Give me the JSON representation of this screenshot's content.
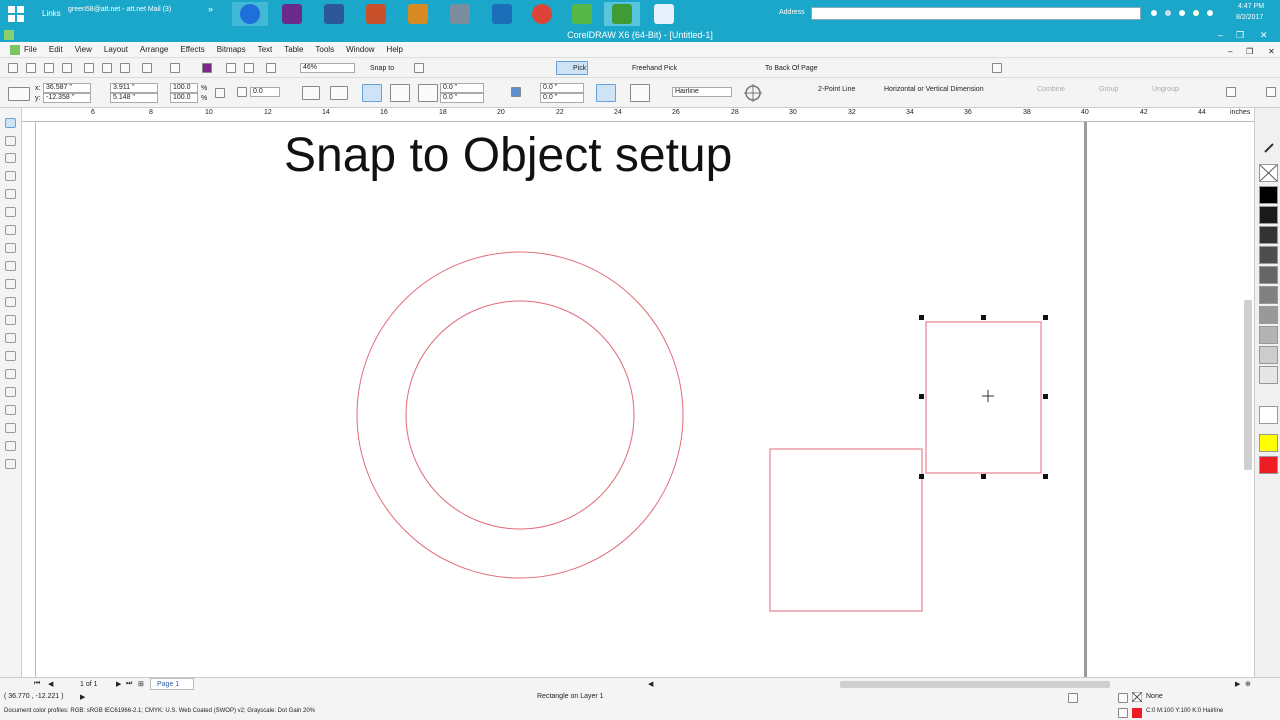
{
  "taskbar": {
    "links_label": "Links",
    "email_label": "green58@att.net - att.net Mail (3)",
    "chevron": "»",
    "address_label": "Address",
    "clock_time": "4:47 PM",
    "clock_date": "8/2/2017"
  },
  "app": {
    "title": "CorelDRAW X6 (64-Bit) - [Untitled-1]"
  },
  "menu": {
    "items": [
      "File",
      "Edit",
      "View",
      "Layout",
      "Arrange",
      "Effects",
      "Bitmaps",
      "Text",
      "Table",
      "Tools",
      "Window",
      "Help"
    ]
  },
  "toolbar1": {
    "zoom": "46%",
    "snap_to": "Snap to",
    "pick": "Pick",
    "freehand_pick": "Freehand Pick",
    "to_back_of_page": "To Back Of Page"
  },
  "toolbar2": {
    "x_label": "x:",
    "x_value": "36.587 \"",
    "y_label": "y:",
    "y_value": "-12.358 \"",
    "width_value": "3.911 \"",
    "height_value": "5.148 \"",
    "scale_x": "100.0",
    "scale_y": "100.0",
    "percent": "%",
    "rotation": "0.0",
    "pos_x1": "0.0 \"",
    "pos_y1": "0.0 \"",
    "pos_x2": "0.0 \"",
    "pos_y2": "0.0 \"",
    "outline": "Hairline",
    "two_point_line": "2-Point Line",
    "dimension": "Horizontal or Vertical Dimension",
    "combine": "Combine",
    "group": "Group",
    "ungroup": "Ungroup"
  },
  "ruler": {
    "ticks": [
      "6",
      "8",
      "10",
      "12",
      "14",
      "16",
      "18",
      "20",
      "22",
      "24",
      "26",
      "28",
      "30",
      "32",
      "34",
      "36",
      "38",
      "40",
      "42",
      "44"
    ],
    "units": "inches"
  },
  "canvas": {
    "heading": "Snap to Object setup",
    "shape_color": "#e06b78"
  },
  "palette": {
    "colors": [
      "#000000",
      "#1a1a1a",
      "#333333",
      "#4d4d4d",
      "#666666",
      "#808080",
      "#999999",
      "#b3b3b3",
      "#cccccc",
      "#e6e6e6",
      "#ffffff",
      "#ffff00",
      "#ee1c25"
    ]
  },
  "status": {
    "page_count": "1 of 1",
    "page_tab": "Page 1",
    "coords": "( 36.770 , -12.221 )",
    "object_info": "Rectangle on Layer 1",
    "fill_none": "None",
    "outline_info": "C:0 M:100 Y:100 K:0  Hairline",
    "profiles": "Document color profiles: RGB: sRGB IEC61966-2.1; CMYK: U.S. Web Coated (SWOP) v2; Grayscale: Dot Gain 20%"
  }
}
